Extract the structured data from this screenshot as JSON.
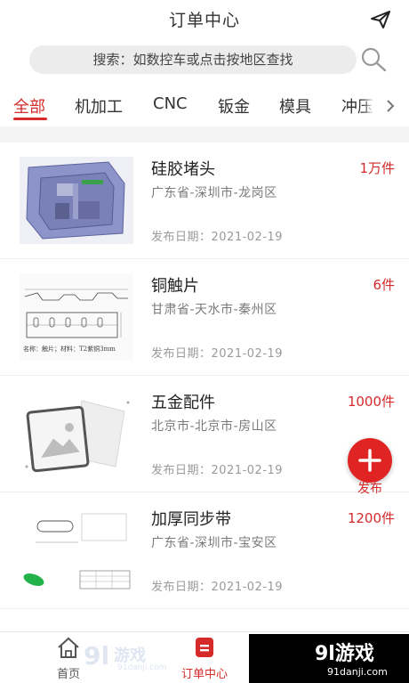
{
  "header": {
    "title": "订单中心",
    "send_icon": "paper-plane-icon"
  },
  "search": {
    "placeholder": "搜索：如数控车或点击按地区查找",
    "icon": "search-icon"
  },
  "tabs": [
    {
      "label": "全部",
      "active": true
    },
    {
      "label": "机加工"
    },
    {
      "label": "CNC"
    },
    {
      "label": "钣金"
    },
    {
      "label": "模具"
    },
    {
      "label": "冲压"
    }
  ],
  "orders": [
    {
      "name": "硅胶堵头",
      "qty": "1万件",
      "region": "广东省-深圳市-龙岗区",
      "date": "发布日期：2021-02-19"
    },
    {
      "name": "铜触片",
      "qty": "6件",
      "region": "甘肃省-天水市-秦州区",
      "date": "发布日期：2021-02-19",
      "drawing_caption": "名称：触片；材料：T2紫铜3mm"
    },
    {
      "name": "五金配件",
      "qty": "1000件",
      "region": "北京市-北京市-房山区",
      "date": "发布日期：2021-02-19"
    },
    {
      "name": "加厚同步带",
      "qty": "1200件",
      "region": "广东省-深圳市-宝安区",
      "date": "发布日期：2021-02-19"
    }
  ],
  "fab": {
    "label": "发布",
    "icon": "plus-icon"
  },
  "bottom_nav": [
    {
      "label": "首页",
      "icon": "home-icon"
    },
    {
      "label": "订单中心",
      "icon": "orders-icon",
      "active": true
    }
  ],
  "watermark": {
    "left_text": "91danji.com",
    "right_big": "9l游戏",
    "right_small": "91danji.com"
  },
  "colors": {
    "accent": "#d52b2b",
    "fab": "#e02424",
    "search_bg": "#ececec"
  }
}
